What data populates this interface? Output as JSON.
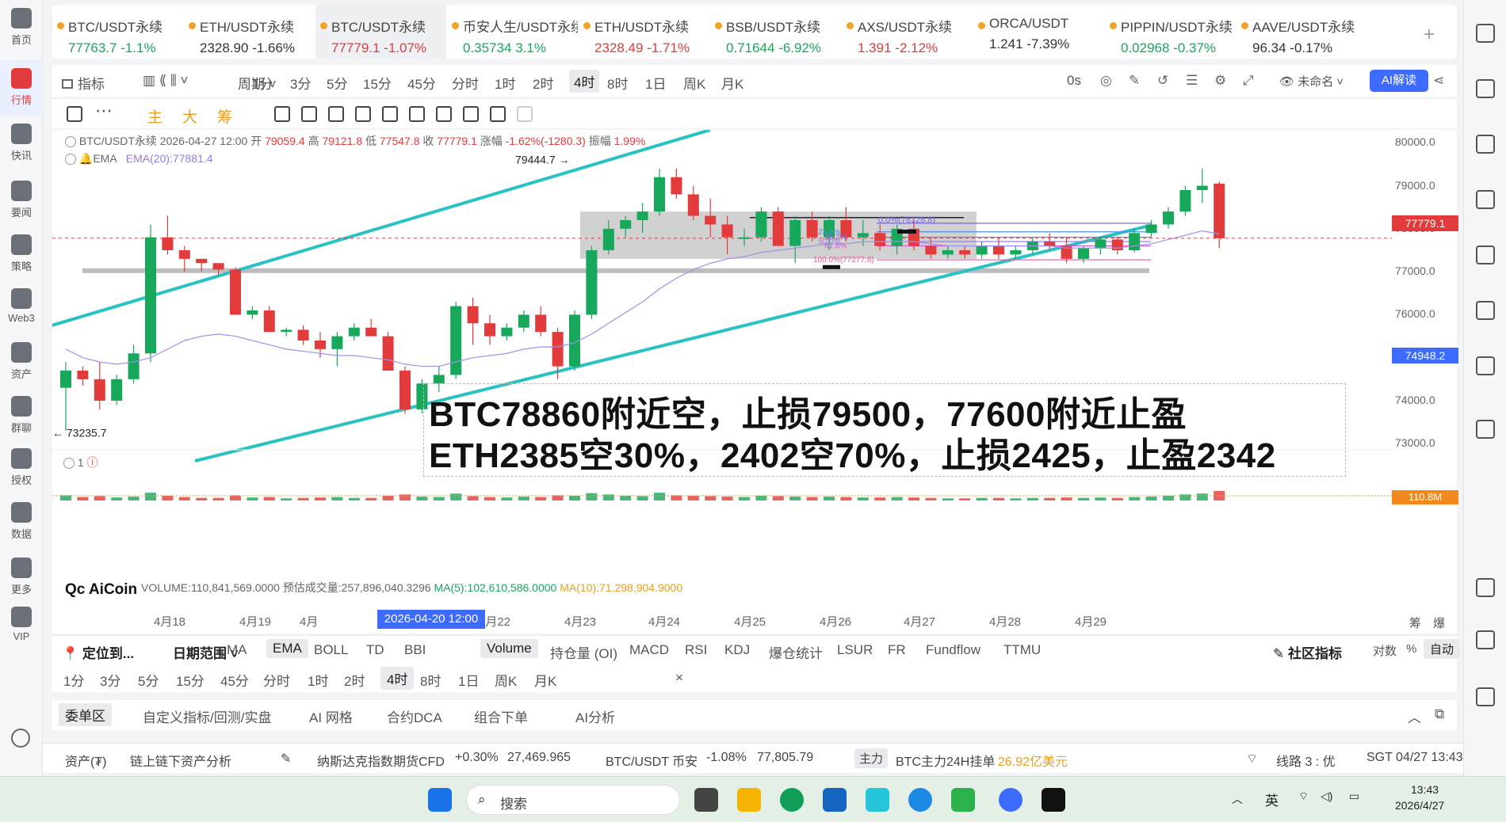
{
  "nav": [
    {
      "label": "首页",
      "active": false
    },
    {
      "label": "行情",
      "active": true
    },
    {
      "label": "快讯",
      "active": false
    },
    {
      "label": "要闻",
      "active": false
    },
    {
      "label": "策略",
      "active": false
    },
    {
      "label": "Web3",
      "active": false
    },
    {
      "label": "资产",
      "active": false
    },
    {
      "label": "群聊",
      "active": false
    },
    {
      "label": "授权",
      "active": false
    },
    {
      "label": "数据",
      "active": false
    },
    {
      "label": "更多",
      "active": false
    },
    {
      "label": "VIP",
      "active": false
    }
  ],
  "tabs": [
    {
      "name": "BTC/USDT永续",
      "price": "77763.7",
      "change": "-1.1%",
      "dir": "up"
    },
    {
      "name": "ETH/USDT永续",
      "price": "2328.90",
      "change": "-1.66%",
      "dir": "neutral"
    },
    {
      "name": "BTC/USDT永续",
      "price": "77779.1",
      "change": "-1.07%",
      "dir": "dn",
      "active": true
    },
    {
      "name": "币安人生/USDT永续",
      "price": "0.35734",
      "change": "3.1%",
      "dir": "up"
    },
    {
      "name": "ETH/USDT永续",
      "price": "2328.49",
      "change": "-1.71%",
      "dir": "dn"
    },
    {
      "name": "BSB/USDT永续",
      "price": "0.71644",
      "change": "-6.92%",
      "dir": "up"
    },
    {
      "name": "AXS/USDT永续",
      "price": "1.391",
      "change": "-2.12%",
      "dir": "dn"
    },
    {
      "name": "ORCA/USDT",
      "price": "1.241",
      "change": "-7.39%",
      "dir": "neutral"
    },
    {
      "name": "PIPPIN/USDT永续",
      "price": "0.02968",
      "change": "-0.37%",
      "dir": "up"
    },
    {
      "name": "AAVE/USDT永续",
      "price": "96.34",
      "change": "-0.17%",
      "dir": "neutral"
    }
  ],
  "toolbar": {
    "indicators": "指标",
    "period": "周期",
    "intervals": [
      "1分",
      "3分",
      "5分",
      "15分",
      "45分",
      "分时",
      "1时",
      "2时",
      "4时",
      "8时",
      "1日",
      "周K",
      "月K"
    ],
    "selected_interval": "4时",
    "countdown": "0s",
    "unnamed": "未命名",
    "ai_button": "AI解读"
  },
  "toolbar2": {
    "labels": [
      "主",
      "大",
      "筹"
    ]
  },
  "chart_header": {
    "line1_prefix": "BTC/USDT永续  2026-04-27 12:00",
    "open_label": "开",
    "open": "79059.4",
    "high_label": "高",
    "high": "79121.8",
    "low_label": "低",
    "low": "77547.8",
    "close_label": "收",
    "close": "77779.1",
    "change_label": "涨幅",
    "change": "-1.62%(-1280.3)",
    "amp_label": "振幅",
    "amp": "1.99%",
    "ema_label": "EMA",
    "ema_value": "EMA(20):77881.4"
  },
  "overlay": {
    "line1": "BTC78860附近空，止损79500，77600附近止盈",
    "line2": "ETH2385空30%，2402空70%，止损2425，止盈2342"
  },
  "volume_legend": {
    "volume": "VOLUME:110,841,569.0000",
    "est": "预估成交量:257,896,040.3296",
    "ma5": "MA(5):102,610,586.0000",
    "ma10": "MA(10):71,298,904.9000",
    "axis_tag": "110.8M"
  },
  "logo": "AiCoin",
  "annotations": {
    "high": "79444.7",
    "low": "73235.7",
    "layer_count": "1"
  },
  "fib_labels": [
    "0.0%(78128.8)",
    "23.6%",
    "38.2%",
    "50.0%",
    "61.8%",
    "100.0%(77277.8)"
  ],
  "y_axis": [
    "80000.0",
    "79000.0",
    "78000.0",
    "77000.0",
    "76000.0",
    "75000.0",
    "74000.0",
    "73000.0"
  ],
  "price_tags": {
    "current": "77779.1",
    "cursor": "74948.2"
  },
  "x_axis": [
    "4月18",
    "4月19",
    "4月",
    "21",
    "4月22",
    "4月23",
    "4月24",
    "4月25",
    "4月26",
    "4月27",
    "4月28",
    "4月29"
  ],
  "x_selected": "2026-04-20 12:00",
  "x_right": [
    "筹",
    "爆"
  ],
  "bottom1": {
    "locate": "定位到...",
    "range": "日期范围",
    "indicators": [
      "MA",
      "EMA",
      "BOLL",
      "TD",
      "BBI",
      "Volume",
      "持仓量 (OI)",
      "MACD",
      "RSI",
      "KDJ",
      "爆仓统计",
      "LSUR",
      "FR",
      "Fundflow",
      "TTMU"
    ],
    "community": "社区指标",
    "log": "对数",
    "pct": "%",
    "auto": "自动"
  },
  "bottom2": {
    "intervals": [
      "1分",
      "3分",
      "5分",
      "15分",
      "45分",
      "分时",
      "1时",
      "2时",
      "4时",
      "8时",
      "1日",
      "周K",
      "月K"
    ],
    "selected": "4时"
  },
  "bottom3": {
    "tabs": [
      "委单区",
      "自定义指标/回测/实盘",
      "AI 网格",
      "合约DCA",
      "组合下单",
      "AI分析"
    ]
  },
  "statusbar": {
    "assets": "资产(₮)",
    "analysis": "链上链下资产分析",
    "nasdaq": "纳斯达克指数期货CFD",
    "nasdaq_change": "+0.30%",
    "nasdaq_price": "27,469.965",
    "btc": "BTC/USDT 币安",
    "btc_change": "-1.08%",
    "btc_price": "77,805.79",
    "main_tag": "主力",
    "main_text": "BTC主力24H挂单",
    "main_value": "26.92亿美元",
    "line": "线路 3 : 优",
    "clock": "SGT 04/27 13:43:10"
  },
  "taskbar": {
    "search": "搜索",
    "ime": "英",
    "time": "13:43",
    "date": "2026/4/27"
  },
  "chart_data": {
    "type": "candlestick",
    "title": "BTC/USDT永续 4时",
    "x": [
      "2026-04-18",
      "2026-04-19",
      "2026-04-20",
      "2026-04-21",
      "2026-04-22",
      "2026-04-23",
      "2026-04-24",
      "2026-04-25",
      "2026-04-26",
      "2026-04-27"
    ],
    "ylim": [
      72600,
      80300
    ],
    "series": [
      {
        "name": "BTC/USDT永续",
        "candles": [
          [
            74300,
            74900,
            73300,
            74700
          ],
          [
            74700,
            74800,
            74350,
            74500
          ],
          [
            74500,
            74900,
            73800,
            74000
          ],
          [
            74000,
            74600,
            73900,
            74500
          ],
          [
            74500,
            75300,
            74400,
            75100
          ],
          [
            75100,
            78100,
            74900,
            77800
          ],
          [
            77800,
            78300,
            77400,
            77500
          ],
          [
            77500,
            77600,
            77000,
            77300
          ],
          [
            77300,
            77300,
            77000,
            77200
          ],
          [
            77200,
            77100,
            76900,
            77050
          ],
          [
            77050,
            77100,
            76000,
            76000
          ],
          [
            76000,
            76200,
            75900,
            76100
          ],
          [
            76100,
            76200,
            75600,
            75600
          ],
          [
            75600,
            75700,
            75500,
            75650
          ],
          [
            75650,
            75750,
            75300,
            75400
          ],
          [
            75400,
            75600,
            75000,
            75200
          ],
          [
            75200,
            75600,
            74800,
            75500
          ],
          [
            75500,
            75800,
            75400,
            75700
          ],
          [
            75700,
            75900,
            75600,
            75500
          ],
          [
            75500,
            75600,
            74700,
            74700
          ],
          [
            74700,
            74800,
            73700,
            73800
          ],
          [
            73800,
            74500,
            73700,
            74400
          ],
          [
            74400,
            74800,
            74200,
            74600
          ],
          [
            74600,
            76300,
            74500,
            76200
          ],
          [
            76200,
            76400,
            75300,
            75800
          ],
          [
            75800,
            76000,
            75300,
            75500
          ],
          [
            75500,
            75800,
            75400,
            75700
          ],
          [
            75700,
            76100,
            75600,
            76000
          ],
          [
            76000,
            76200,
            75500,
            75600
          ],
          [
            75600,
            75700,
            74500,
            74800
          ],
          [
            74800,
            76100,
            74700,
            76000
          ],
          [
            76000,
            77600,
            75900,
            77500
          ],
          [
            77500,
            78200,
            77400,
            78000
          ],
          [
            78000,
            78300,
            77800,
            78200
          ],
          [
            78200,
            78600,
            77900,
            78400
          ],
          [
            78400,
            79400,
            78300,
            79200
          ],
          [
            79200,
            79400,
            78700,
            78800
          ],
          [
            78800,
            79000,
            78200,
            78300
          ],
          [
            78300,
            78700,
            77800,
            78100
          ],
          [
            78100,
            78300,
            77400,
            77800
          ],
          [
            77800,
            78000,
            77600,
            77800
          ],
          [
            77800,
            78500,
            77700,
            78400
          ],
          [
            78400,
            78500,
            77600,
            77600
          ],
          [
            77600,
            78300,
            77200,
            78200
          ],
          [
            78200,
            78400,
            77700,
            77800
          ],
          [
            77800,
            78300,
            77500,
            78200
          ],
          [
            78200,
            78500,
            77700,
            77800
          ],
          [
            77800,
            78200,
            77600,
            77900
          ],
          [
            77900,
            78100,
            77500,
            77600
          ],
          [
            77600,
            78100,
            77400,
            78000
          ],
          [
            78000,
            78200,
            77500,
            77600
          ],
          [
            77600,
            77800,
            77300,
            77400
          ],
          [
            77400,
            77600,
            77300,
            77500
          ],
          [
            77500,
            77600,
            77300,
            77400
          ],
          [
            77400,
            77700,
            77300,
            77600
          ],
          [
            77600,
            77800,
            77300,
            77400
          ],
          [
            77400,
            77600,
            77300,
            77500
          ],
          [
            77500,
            77800,
            77400,
            77700
          ],
          [
            77700,
            77900,
            77500,
            77600
          ],
          [
            77600,
            77800,
            77200,
            77300
          ],
          [
            77300,
            77600,
            77200,
            77550
          ],
          [
            77550,
            77800,
            77400,
            77750
          ],
          [
            77750,
            77800,
            77400,
            77500
          ],
          [
            77500,
            78000,
            77450,
            77900
          ],
          [
            77900,
            78200,
            77800,
            78100
          ],
          [
            78100,
            78500,
            78000,
            78400
          ],
          [
            78400,
            79000,
            78300,
            78900
          ],
          [
            78900,
            79400,
            78600,
            79000
          ],
          [
            79050,
            79100,
            77550,
            77780
          ]
        ]
      }
    ],
    "ema20": [
      75200,
      75000,
      74900,
      74850,
      74900,
      75000,
      75200,
      75400,
      75500,
      75550,
      75500,
      75400,
      75300,
      75200,
      75150,
      75100,
      75050,
      75050,
      75000,
      74950,
      74850,
      74800,
      74800,
      74900,
      75000,
      75050,
      75100,
      75200,
      75250,
      75250,
      75350,
      75550,
      75800,
      76050,
      76300,
      76600,
      76850,
      77050,
      77200,
      77300,
      77350,
      77450,
      77500,
      77550,
      77600,
      77650,
      77650,
      77700,
      77700,
      77700,
      77700,
      77650,
      77600,
      77600,
      77600,
      77600,
      77600,
      77600,
      77600,
      77550,
      77550,
      77550,
      77550,
      77600,
      77650,
      77750,
      77850,
      77950,
      77880
    ],
    "volume": [
      60,
      40,
      50,
      35,
      45,
      90,
      55,
      40,
      30,
      30,
      60,
      35,
      40,
      25,
      30,
      35,
      40,
      30,
      30,
      55,
      70,
      45,
      40,
      80,
      50,
      40,
      35,
      45,
      40,
      60,
      55,
      85,
      70,
      55,
      50,
      90,
      60,
      55,
      50,
      45,
      40,
      55,
      50,
      45,
      40,
      45,
      40,
      35,
      35,
      40,
      35,
      30,
      25,
      25,
      30,
      30,
      25,
      30,
      30,
      35,
      30,
      35,
      30,
      40,
      45,
      55,
      70,
      80,
      110
    ]
  }
}
